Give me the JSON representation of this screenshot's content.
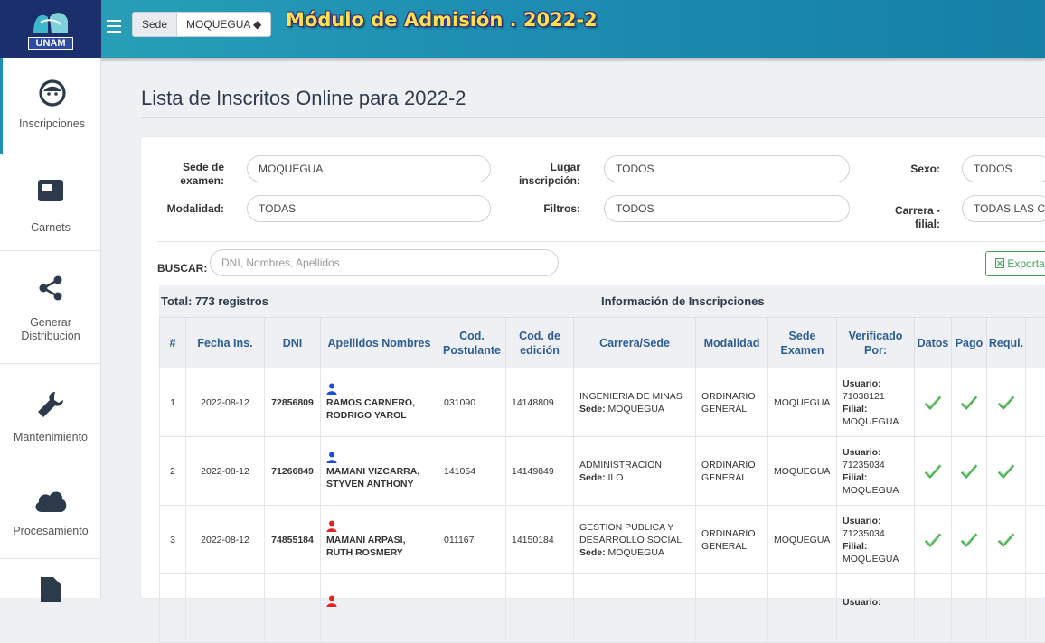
{
  "header": {
    "logo_text": "UNAM",
    "sede_label": "Sede",
    "sede_value": "MOQUEGUA ◆",
    "app_title": "Módulo de Admisión . 2022-2"
  },
  "sidebar": {
    "items": [
      {
        "label": "Inscripciones",
        "icon": "face-icon"
      },
      {
        "label": "Carnets",
        "icon": "card-icon"
      },
      {
        "label": "Generar Distribución",
        "icon": "share-icon"
      },
      {
        "label": "Mantenimiento",
        "icon": "wrench-icon"
      },
      {
        "label": "Procesamiento",
        "icon": "cloud-icon"
      }
    ]
  },
  "page": {
    "title": "Lista de Inscritos Online para 2022-2"
  },
  "filters": {
    "sede_examen_label": "Sede de examen:",
    "sede_examen_value": "MOQUEGUA",
    "lugar_label": "Lugar inscripción:",
    "lugar_value": "TODOS",
    "sexo_label": "Sexo:",
    "sexo_value": "TODOS",
    "modalidad_label": "Modalidad:",
    "modalidad_value": "TODAS",
    "filtros_label": "Filtros:",
    "filtros_value": "TODOS",
    "carrera_label": "Carrera - filial:",
    "carrera_value": "TODAS LAS C"
  },
  "search": {
    "label": "BUSCAR:",
    "placeholder": "DNI, Nombres, Apellidos"
  },
  "export_label": "Exporta",
  "table": {
    "total": "Total: 773 registros",
    "info": "Información de Inscripciones",
    "headers": [
      "#",
      "Fecha Ins.",
      "DNI",
      "Apellidos Nombres",
      "Cod. Postulante",
      "Cod. de edición",
      "Carrera/Sede",
      "Modalidad",
      "Sede Examen",
      "Verificado Por:",
      "Datos",
      "Pago",
      "Requi."
    ],
    "rows": [
      {
        "num": "1",
        "fecha": "2022-08-12",
        "dni": "72856809",
        "gender": "male",
        "name1": "RAMOS CARNERO,",
        "name2": "RODRIGO YAROL",
        "cod": "031090",
        "edicion": "14148809",
        "carrera": "INGENIERIA DE MINAS",
        "sede": "MOQUEGUA",
        "mod1": "ORDINARIO",
        "mod2": "GENERAL",
        "examen": "MOQUEGUA",
        "usuario": "71038121",
        "filial": "MOQUEGUA"
      },
      {
        "num": "2",
        "fecha": "2022-08-12",
        "dni": "71266849",
        "gender": "male",
        "name1": "MAMANI VIZCARRA,",
        "name2": "STYVEN ANTHONY",
        "cod": "141054",
        "edicion": "14149849",
        "carrera": "ADMINISTRACION",
        "sede": "ILO",
        "mod1": "ORDINARIO",
        "mod2": "GENERAL",
        "examen": "MOQUEGUA",
        "usuario": "71235034",
        "filial": "MOQUEGUA"
      },
      {
        "num": "3",
        "fecha": "2022-08-12",
        "dni": "74855184",
        "gender": "female",
        "name1": "MAMANI ARPASI,",
        "name2": "RUTH ROSMERY",
        "cod": "011167",
        "edicion": "14150184",
        "carrera": "GESTION PUBLICA Y DESARROLLO SOCIAL",
        "sede": "MOQUEGUA",
        "mod1": "ORDINARIO",
        "mod2": "GENERAL",
        "examen": "MOQUEGUA",
        "usuario": "71235034",
        "filial": "MOQUEGUA"
      },
      {
        "num": "",
        "fecha": "",
        "dni": "",
        "gender": "female",
        "name1": "",
        "name2": "",
        "cod": "",
        "edicion": "",
        "carrera": "",
        "sede": "",
        "mod1": "",
        "mod2": "",
        "examen": "",
        "usuario": "",
        "filial": ""
      }
    ],
    "usuario_label": "Usuario:",
    "filial_label": "Filial:",
    "sede_label": "Sede:"
  },
  "colors": {
    "male": "#1a4fd6",
    "female": "#e02424",
    "check": "#4caf50",
    "brand": "#1e8fb2"
  }
}
